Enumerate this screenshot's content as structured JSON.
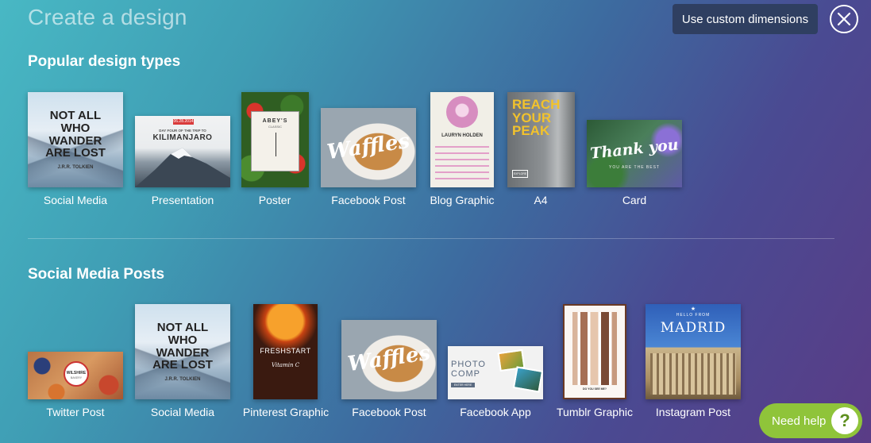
{
  "header": {
    "title": "Create a design",
    "custom_dimensions_label": "Use custom dimensions"
  },
  "popular": {
    "title": "Popular design types",
    "items": [
      {
        "label": "Social Media",
        "thumb_text": "NOT ALL WHO WANDER ARE LOST",
        "thumb_sub": "J.R.R. TOLKIEN"
      },
      {
        "label": "Presentation",
        "thumb_text": "KILIMANJARO",
        "thumb_sub": "DAY FOUR OF THE TRIP TO",
        "thumb_date": "06.28.2014"
      },
      {
        "label": "Poster",
        "thumb_text": "ABEY'S",
        "thumb_sub": "CLASSIC"
      },
      {
        "label": "Facebook Post",
        "thumb_text": "Waffles"
      },
      {
        "label": "Blog Graphic",
        "thumb_text": "LAURYN HOLDEN"
      },
      {
        "label": "A4",
        "thumb_text": "REACH YOUR PEAK",
        "thumb_sub": "EXPLORE"
      },
      {
        "label": "Card",
        "thumb_text": "Thank you",
        "thumb_sub": "YOU ARE THE BEST"
      }
    ]
  },
  "social": {
    "title": "Social Media Posts",
    "items": [
      {
        "label": "Twitter Post",
        "thumb_text": "WILSHIRE",
        "thumb_sub": "BAKERY"
      },
      {
        "label": "Social Media",
        "thumb_text": "NOT ALL WHO WANDER ARE LOST",
        "thumb_sub": "J.R.R. TOLKIEN"
      },
      {
        "label": "Pinterest Graphic",
        "thumb_text": "FRESHSTART",
        "thumb_sub": "Vitamin C"
      },
      {
        "label": "Facebook Post",
        "thumb_text": "Waffles"
      },
      {
        "label": "Facebook App",
        "thumb_text": "PHOTO COMP",
        "thumb_sub": "ENTER HERE"
      },
      {
        "label": "Tumblr Graphic",
        "thumb_text": "DO YOU SEE ME?"
      },
      {
        "label": "Instagram Post",
        "thumb_text": "MADRID",
        "thumb_sub": "HELLO FROM"
      }
    ]
  },
  "help": {
    "label": "Need help",
    "icon_glyph": "?"
  },
  "icons": {
    "close": "close-icon",
    "help": "question-icon"
  }
}
